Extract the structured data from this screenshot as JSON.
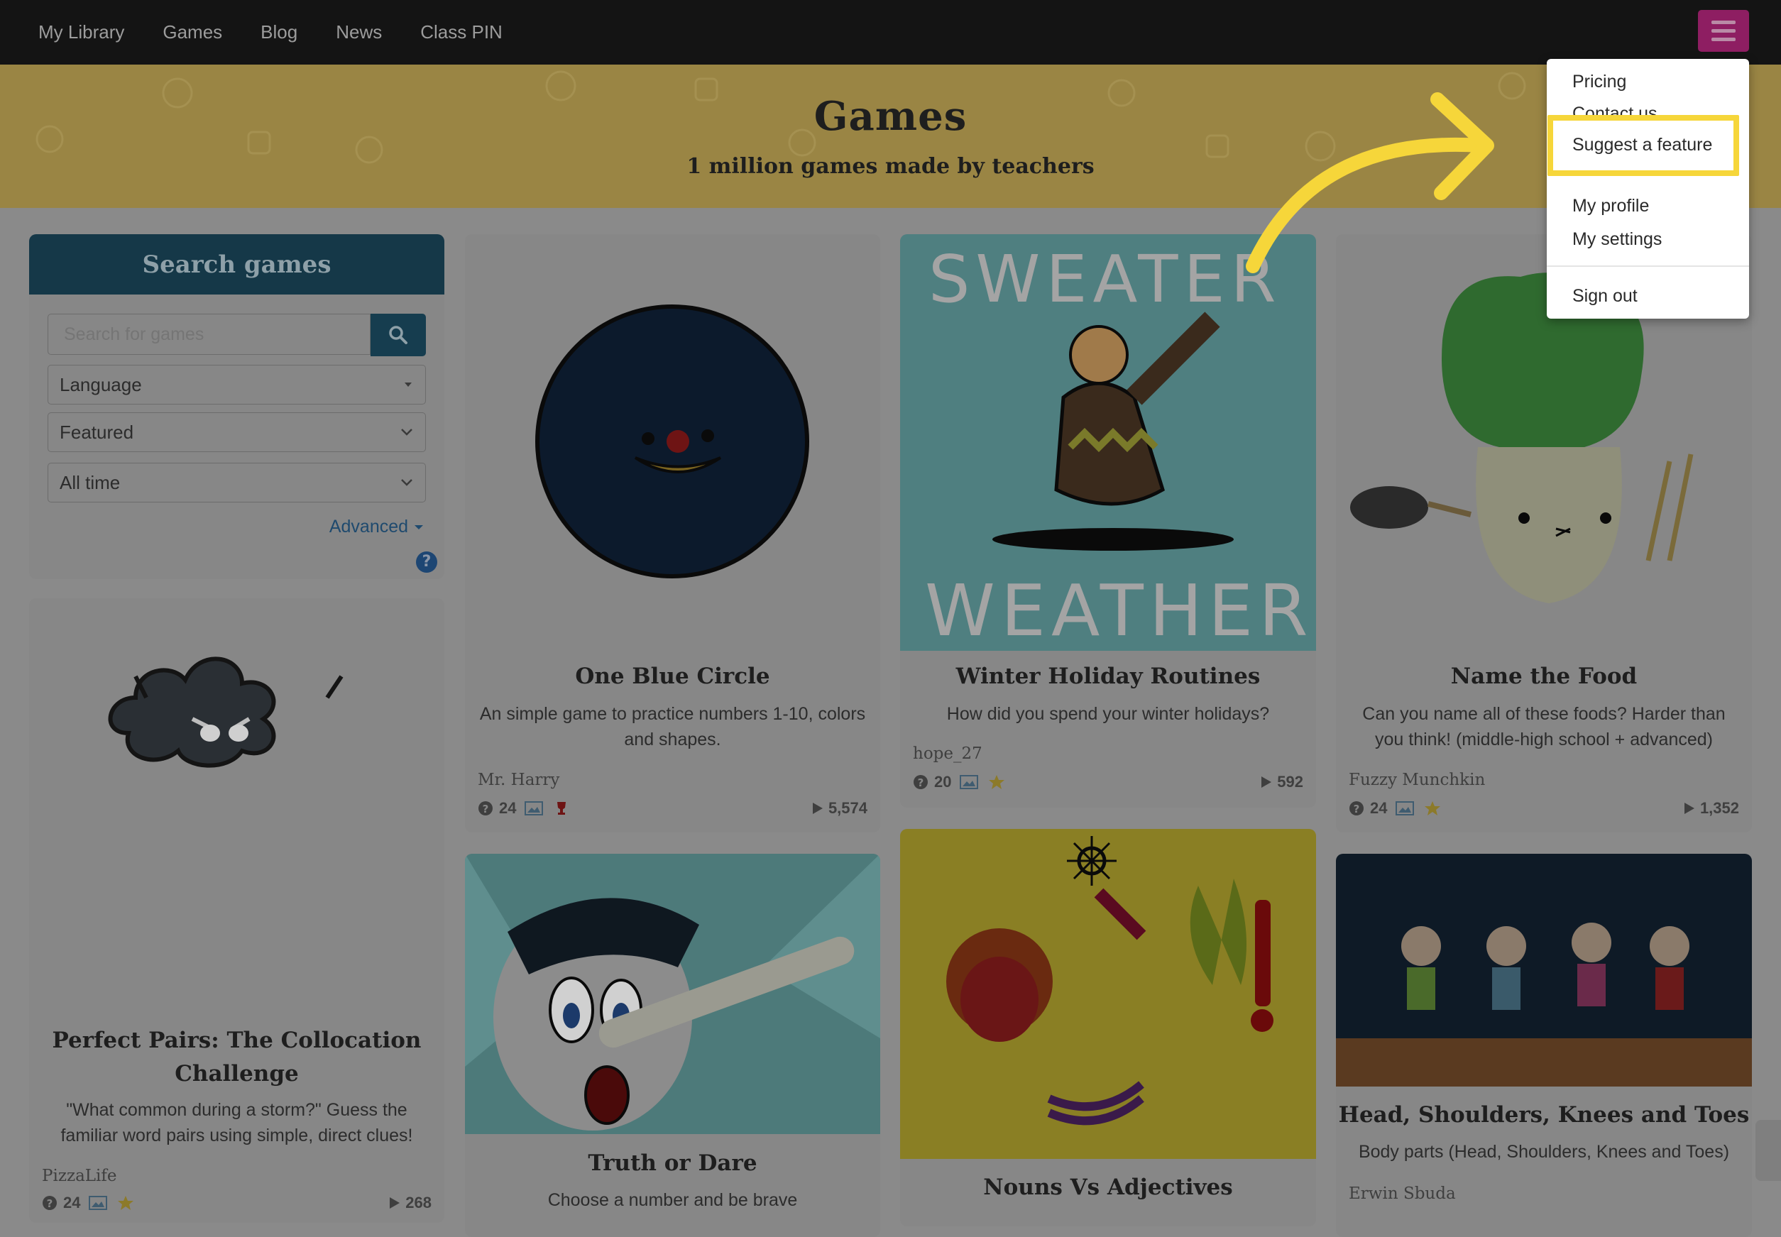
{
  "nav": {
    "links": [
      "My Library",
      "Games",
      "Blog",
      "News",
      "Class PIN"
    ],
    "menu_icon": "hamburger-icon"
  },
  "banner": {
    "title": "Games",
    "subtitle": "1 million games made by teachers"
  },
  "search": {
    "heading": "Search games",
    "placeholder": "Search for games",
    "language": "Language",
    "sort": "Featured",
    "time": "All time",
    "advanced": "Advanced",
    "help": "?"
  },
  "cards": [
    {
      "title": "One Blue Circle",
      "desc": "An simple game to practice numbers 1-10, colors and shapes.",
      "author": "Mr. Harry",
      "questions": "24",
      "plays": "5,574"
    },
    {
      "title": "Winter Holiday Routines",
      "desc": "How did you spend your winter holidays?",
      "author": "hope_27",
      "questions": "20",
      "plays": "592",
      "art_top": "SWEATER",
      "art_bottom": "WEATHER"
    },
    {
      "title": "Name the Food",
      "desc": "Can you name all of these foods? Harder than you think! (middle-high school + advanced)",
      "author": "Fuzzy Munchkin",
      "questions": "24",
      "plays": "1,352"
    },
    {
      "title": "Perfect Pairs: The Collocation Challenge",
      "desc": "\"What common during a storm?\" Guess the familiar word pairs using simple, direct clues!",
      "author": "PizzaLife",
      "questions": "24",
      "plays": "268"
    },
    {
      "title": "Truth or Dare",
      "desc": "Choose a number and be brave"
    },
    {
      "title": "Nouns Vs Adjectives"
    },
    {
      "title": "Head, Shoulders, Knees and Toes",
      "desc": "Body parts (Head, Shoulders, Knees and Toes)",
      "author": "Erwin Sbuda"
    }
  ],
  "dropdown": {
    "items": [
      "Pricing",
      "Contact us",
      "Suggest a feature",
      "My profile",
      "My settings",
      "Sign out"
    ]
  },
  "colors": {
    "navbar": "#141414",
    "menu_button": "#8e1e62",
    "banner": "#9a8544",
    "search_header": "#153848",
    "highlight": "#f6d63a"
  }
}
